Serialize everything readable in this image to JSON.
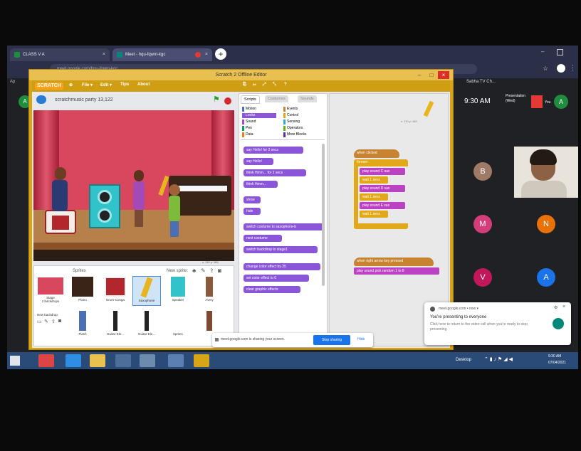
{
  "browser": {
    "tabs": [
      {
        "label": "CLASS V A",
        "close": "×"
      },
      {
        "label": "Meet - hqu-fqwm-kgc",
        "close": "×"
      }
    ],
    "new_tab": "+",
    "address": "meet.google.com/hqu-fqwm-kgc",
    "bookmark": "Sabha TV Ch..."
  },
  "scratch": {
    "title": "Scratch 2 Offline Editor",
    "logo": "SCRATCH",
    "menus": [
      "File ▾",
      "Edit ▾",
      "Tips",
      "About"
    ],
    "project_name": "scratchmusic party 13,122",
    "tabs": [
      "Scripts",
      "Costumes",
      "Sounds"
    ],
    "categories_left": [
      "Motion",
      "Looks",
      "Sound",
      "Pen",
      "Data"
    ],
    "categories_right": [
      "Events",
      "Control",
      "Sensing",
      "Operators",
      "More Blocks"
    ],
    "palette_blocks": [
      "say Hello! for 2 secs",
      "say Hello!",
      "think Hmm... for 2 secs",
      "think Hmm...",
      "show",
      "hide",
      "switch costume to saxophone-b",
      "next costume",
      "switch backdrop to stage1",
      "change color effect by 25",
      "set color effect to 0",
      "clear graphic effects"
    ],
    "script1": {
      "hat": "when clicked",
      "loop": "forever",
      "blocks": [
        "play sound C sax",
        "wait 1 secs",
        "play sound D sax",
        "wait 1 secs",
        "play sound E sax",
        "wait 1 secs"
      ]
    },
    "script2": {
      "hat": "when right arrow key pressed",
      "blocks": [
        "play sound pick random 1 to 8"
      ]
    },
    "zoom": "= ⌕",
    "stage_coords": "x: 110  y: 169",
    "sprites_label": "Sprites",
    "new_sprite_label": "New sprite:",
    "stage_label": "Stage",
    "stage_backdrops": "2 backdrops",
    "new_backdrop_label": "New backdrop:",
    "sprites": [
      "Piano",
      "Drum-Conga",
      "Saxophone",
      "Speaker",
      "Avery",
      "Flash",
      "Guitar-Ele...",
      "Guitar-Ele...",
      "Sprite1",
      ""
    ]
  },
  "meet": {
    "time": "9:30 AM",
    "presentation": "Presentation (Wed)",
    "you_label": "You",
    "participants": [
      {
        "initial": "B",
        "color": "#9f7a67"
      },
      {
        "initial": "M",
        "color": "#d33e7a"
      },
      {
        "initial": "N",
        "color": "#e8710a"
      },
      {
        "initial": "V",
        "color": "#c2185b"
      },
      {
        "initial": "A",
        "color": "#1a73e8"
      }
    ],
    "avatar_initial": "A",
    "notification": {
      "source": "meet.google.com • now ▾",
      "title": "You're presenting to everyone",
      "body": "Click here to return to the video call when you're ready to stop presenting"
    },
    "share_text": "meet.google.com is sharing your screen.",
    "stop_sharing": "Stop sharing",
    "hide": "Hide"
  },
  "taskbar": {
    "desktop_label": "Desktop",
    "clock_time": "9:30 AM",
    "clock_date": "07/04/2021"
  }
}
